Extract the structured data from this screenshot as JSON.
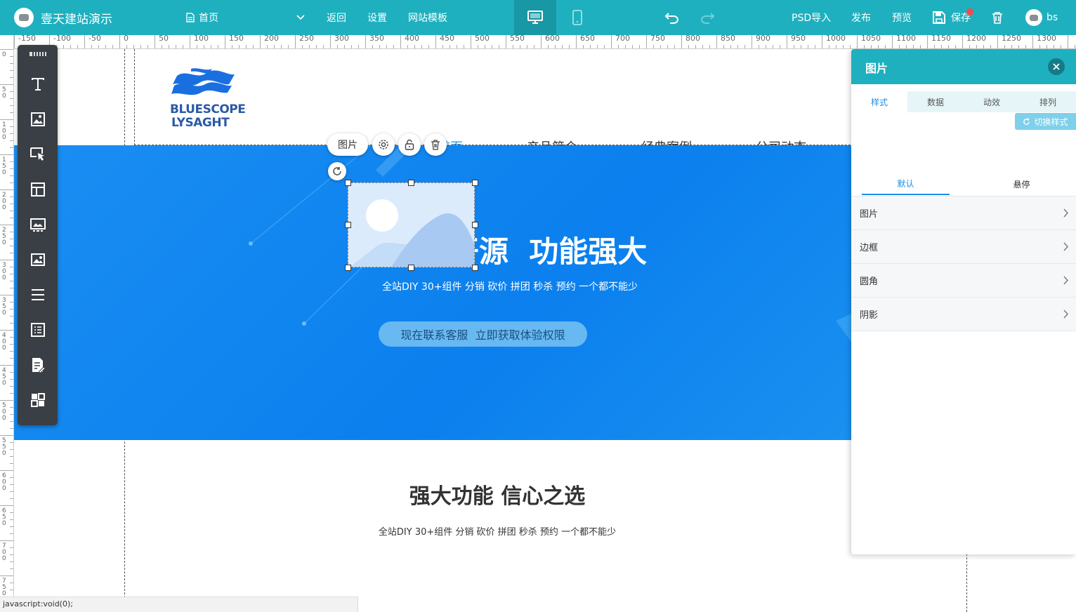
{
  "app": {
    "title": "壹天建站演示",
    "page_select": "首页"
  },
  "toolbar": {
    "back": "返回",
    "settings": "设置",
    "templates": "网站模板",
    "psd_import": "PSD导入",
    "publish": "发布",
    "preview": "预览",
    "save": "保存",
    "user": "bs"
  },
  "ruler": {
    "h_ticks": [
      "-150",
      "-100",
      "-50",
      "0",
      "50",
      "100",
      "150",
      "200",
      "250",
      "300",
      "350",
      "400",
      "450",
      "500",
      "550",
      "600",
      "650",
      "700",
      "750",
      "800",
      "850",
      "900",
      "950",
      "1000",
      "1050",
      "1100",
      "1150",
      "1200",
      "1250",
      "1300"
    ],
    "v_ticks": [
      "0",
      "50",
      "100",
      "150",
      "200",
      "250",
      "300",
      "350",
      "400",
      "450",
      "500",
      "550",
      "600",
      "650",
      "700",
      "750"
    ]
  },
  "tools": [
    "text-tool-icon",
    "image-tool-icon",
    "pointer-tool-icon",
    "layout-tool-icon",
    "gallery-tool-icon",
    "picture-tool-icon",
    "menu-tool-icon",
    "list-tool-icon",
    "form-tool-icon",
    "components-tool-icon"
  ],
  "site": {
    "logo_line1": "BLUESCOPE",
    "logo_line2": "LYSAGHT",
    "nav": [
      "首页",
      "产品简介",
      "经典案例",
      "公司动态"
    ],
    "hero_title": "开源  功能强大",
    "hero_sub": "全站DIY 30+组件 分销 砍价 拼团 秒杀 预约 一个都不能少",
    "hero_btn": "现在联系客服  立即获取体验权限",
    "section_title": "强大功能 信心之选",
    "section_sub": "全站DIY 30+组件 分销 砍价 拼团 秒杀 预约 一个都不能少"
  },
  "selection": {
    "label": "图片"
  },
  "panel": {
    "title": "图片",
    "tabs": [
      "样式",
      "数据",
      "动效",
      "排列"
    ],
    "switch_style": "切换样式",
    "subtabs": [
      "默认",
      "悬停"
    ],
    "rows": [
      "图片",
      "边框",
      "圆角",
      "阴影"
    ]
  },
  "status": "javascript:void(0);",
  "colors": {
    "topbar": "#1eb0bf",
    "hero": "#0c86f0",
    "accent": "#1a8fe6"
  }
}
